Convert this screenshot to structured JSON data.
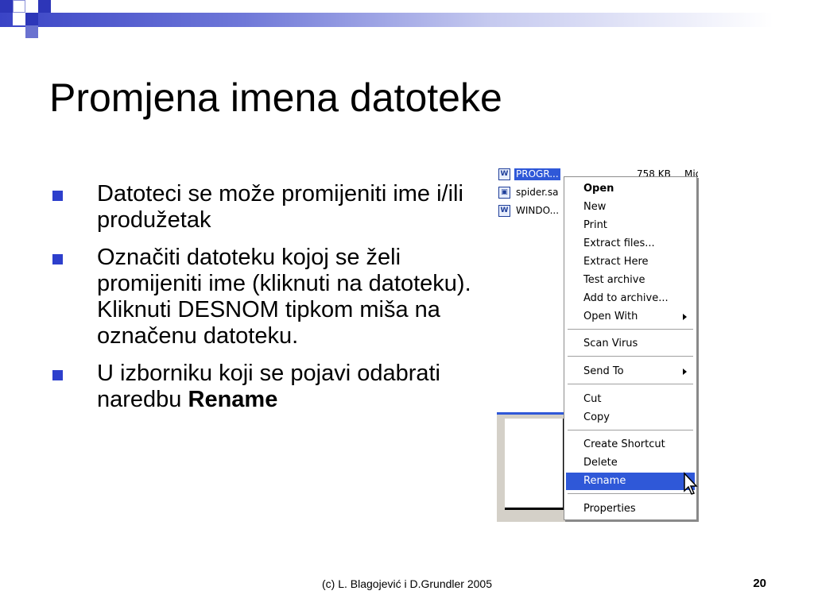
{
  "slide": {
    "title": "Promjena imena datoteke",
    "bullets": [
      "Datoteci se može promijeniti ime i/ili produžetak",
      "Označiti datoteku kojoj se želi promijeniti ime (kliknuti na datoteku). Kliknuti DESNOM tipkom miša na označenu datoteku.",
      "U izborniku koji se pojavi odabrati naredbu "
    ],
    "bullet3_bold": "Rename",
    "footer": "(c) L. Blagojević i D.Grundler 2005",
    "page_number": "20"
  },
  "explorer": {
    "files": [
      {
        "name": "PROGR...",
        "size": "758 KB",
        "type": "Mic",
        "icon": "word-doc-icon",
        "selected": true
      },
      {
        "name": "spider.sa",
        "size": "",
        "type": "",
        "icon": "game-file-icon",
        "selected": false
      },
      {
        "name": "WINDO...",
        "size": "",
        "type": "",
        "icon": "word-doc-icon",
        "selected": false
      }
    ]
  },
  "context_menu": {
    "items": [
      {
        "label": "Open",
        "bold": true
      },
      {
        "label": "New"
      },
      {
        "label": "Print"
      },
      {
        "label": "Extract files..."
      },
      {
        "label": "Extract Here"
      },
      {
        "label": "Test archive"
      },
      {
        "label": "Add to archive..."
      },
      {
        "label": "Open With",
        "submenu": true
      },
      {
        "label": "Scan Virus"
      },
      {
        "label": "Send To",
        "submenu": true
      },
      {
        "label": "Cut"
      },
      {
        "label": "Copy"
      },
      {
        "label": "Create Shortcut"
      },
      {
        "label": "Delete"
      },
      {
        "label": "Rename",
        "highlighted": true
      },
      {
        "label": "Properties"
      }
    ]
  },
  "colors": {
    "accent": "#2d3fcc",
    "selection": "#2f58d8"
  }
}
